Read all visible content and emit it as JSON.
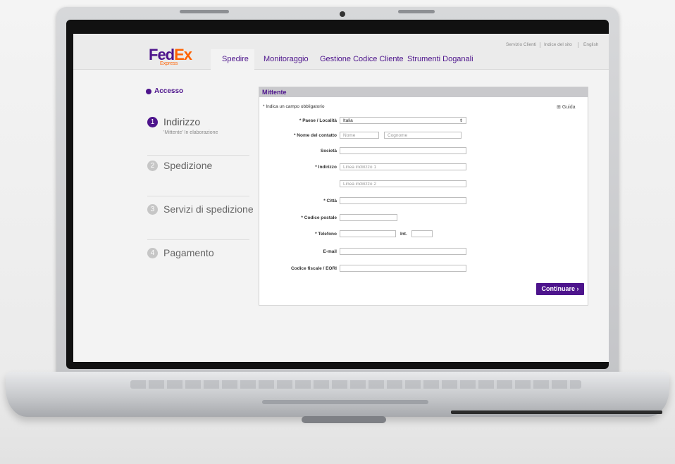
{
  "header": {
    "logo_fed": "Fed",
    "logo_ex": "Ex",
    "logo_sub": "Express",
    "nav": [
      {
        "label": "Spedire"
      },
      {
        "label": "Monitoraggio"
      },
      {
        "label": "Gestione Codice Cliente"
      },
      {
        "label": "Strumenti Doganali"
      }
    ],
    "utility": [
      "Servizio Clienti",
      "Indice del sito",
      "English"
    ]
  },
  "sidebar": {
    "access": "Accesso",
    "steps": [
      {
        "num": "1",
        "label": "Indirizzo",
        "sub": "'Mittente' In elaborazione",
        "active": true
      },
      {
        "num": "2",
        "label": "Spedizione"
      },
      {
        "num": "3",
        "label": "Servizi di spedizione"
      },
      {
        "num": "4",
        "label": "Pagamento"
      }
    ]
  },
  "form": {
    "title": "Mittente",
    "required_note": "* Indica un campo obbligatorio",
    "help": "Guida",
    "fields": {
      "country_label": "* Paese / Località",
      "country_value": "Italia",
      "contact_label": "* Nome del contatto",
      "first_name_ph": "Nome",
      "last_name_ph": "Cognome",
      "company_label": "Società",
      "address_label": "* Indirizzo",
      "address1_ph": "Linea indirizzo 1",
      "address2_ph": "Linea indirizzo 2",
      "city_label": "* Città",
      "postal_label": "* Codice postale",
      "phone_label": "* Telefono",
      "ext_label": "Int.",
      "email_label": "E-mail",
      "tax_label": "Codice fiscale / EORI"
    },
    "continue_label": "Continuare"
  },
  "colors": {
    "brand_purple": "#4d148c",
    "brand_orange": "#ff6200"
  }
}
